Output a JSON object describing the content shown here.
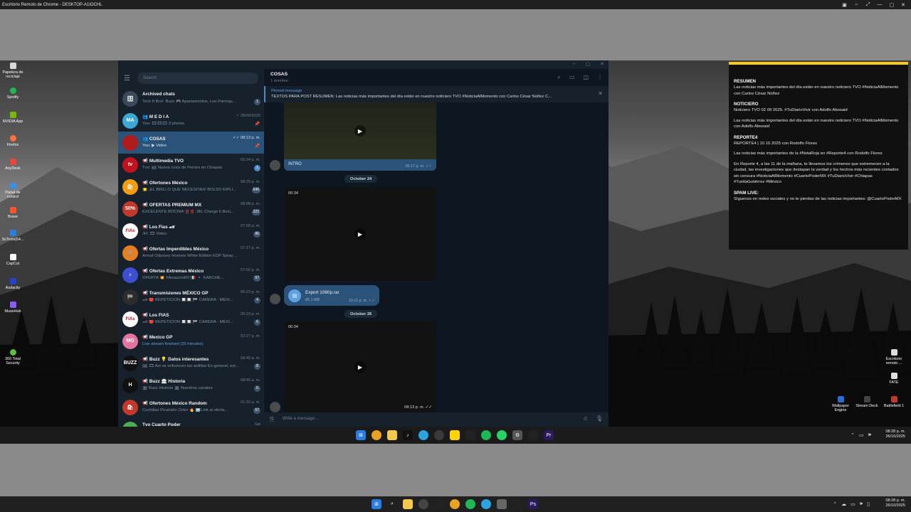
{
  "crd": {
    "title": "Escritorio Remoto de Chrome - DESKTOP-A1IOCHL",
    "controls": [
      "▣",
      "⇔",
      "⤢",
      "—",
      "▢",
      "✕"
    ]
  },
  "desktop_icons_left": [
    {
      "label": "Papelera de reciclaje",
      "color": "#d9d9d9"
    },
    {
      "label": "Spotify",
      "color": "#1db954"
    },
    {
      "label": "NVIDIA App",
      "color": "#76b900"
    },
    {
      "label": "Firefox",
      "color": "#ff7139"
    },
    {
      "label": "AnyDesk",
      "color": "#ef443b"
    },
    {
      "label": "Panel de control",
      "color": "#3c8dde"
    },
    {
      "label": "Brave",
      "color": "#fb542b"
    },
    {
      "label": "3uTools(64...",
      "color": "#2a7de1"
    },
    {
      "label": "CapCut",
      "color": "#ffffff"
    },
    {
      "label": "Audacity",
      "color": "#0000cc"
    },
    {
      "label": "MuseHub",
      "color": "#8a5cf6"
    },
    {
      "label": "360 Total Security",
      "color": "#5fbf3a"
    }
  ],
  "desktop_icons_right": [
    {
      "label": "Escritorio remoto ...",
      "color": "#dddddd"
    },
    {
      "label": "FATE",
      "color": "#dddddd"
    }
  ],
  "desktop_icons_bottom_right": [
    {
      "label": "Wallpaper Engine",
      "color": "#2a6bd6"
    },
    {
      "label": "Stream Deck",
      "color": "#333"
    },
    {
      "label": "Battlefield 1",
      "color": "#c0392b"
    }
  ],
  "telegram": {
    "search_placeholder": "Search",
    "chats": [
      {
        "name": "Archived chats",
        "preview": "Tech It Bro!: Buzz 🎮 Apartamentos, Leo Parroqu...",
        "time": "",
        "badge": "1",
        "avatar_text": "🗄",
        "avatar_color": "#3b4a5a",
        "badge_blue": false
      },
      {
        "name": "👥 M E D I A",
        "preview": "You: 🎞🎞🎞 3 photos",
        "time": "✓ 28/09/2025",
        "badge": "",
        "avatar_text": "MA",
        "avatar_color": "#3ba8d6",
        "pinned": true
      },
      {
        "name": "👥 COSAS",
        "preview": "You: ▶ Video",
        "time": "✓✓ 08:13 p. m.",
        "badge": "",
        "avatar_text": "",
        "avatar_color": "#b01b1b",
        "active": true,
        "pinned": true
      },
      {
        "name": "📢 Multimedia TVO",
        "preview": "Tvo: 🏞 Nueva crisis de Pemex en Chiapas",
        "time": "05:34 p. m.",
        "badge": "1",
        "avatar_text": "tv",
        "avatar_color": "#c1121f",
        "badge_blue": true
      },
      {
        "name": "📢 Ofertones México",
        "preview": "🌟 ¡EL BRILLO QUE NECESITAS! BOLSO KIPLI...",
        "time": "08:25 p. m.",
        "badge": "646",
        "avatar_text": "🛍",
        "avatar_color": "#f39c12"
      },
      {
        "name": "📢 OFERTAS PREMIUM MX",
        "preview": "EXCELENTE BOCINA ‼️‼️ JBL Charge 6 Boci...",
        "time": "08:08 p. m.",
        "badge": "222",
        "avatar_text": "50%",
        "avatar_color": "#c0392b"
      },
      {
        "name": "📢 Los Fias 🏎",
        "preview": "JH: 🎞 Video",
        "time": "07:58 p. m.",
        "badge": "86",
        "avatar_text": "FIAs",
        "avatar_color": "#ffffff"
      },
      {
        "name": "📢 Ofertas Imperdibles México",
        "preview": "Armaf Odyssey Homme White Edition EDP Spray ...",
        "time": "07:17 p. m.",
        "badge": "",
        "avatar_text": "🛒",
        "avatar_color": "#e67e22"
      },
      {
        "name": "📢 Ofertas Extremas México",
        "preview": "OFERTA 💥 #AmazonMX 🇲🇽 🔹 KARCHE...",
        "time": "07:00 p. m.",
        "badge": "57",
        "avatar_text": "⚡",
        "avatar_color": "#3e4fd1"
      },
      {
        "name": "📢 Transmisiones MÉXICO GP",
        "preview": "🏎 🔴 REPETICIÓN 🔲🔲 🏁 CARERA - MEXI...",
        "time": "06:23 p. m.",
        "badge": "4",
        "avatar_text": "🏁",
        "avatar_color": "#2c2c2c"
      },
      {
        "name": "📢 Los FIAS",
        "preview": "🏎 🔴 REPETICIÓN 🔲🔲 🏁 CARERA - MEXI...",
        "time": "06:23 p. m.",
        "badge": "6",
        "avatar_text": "FIAs",
        "avatar_color": "#ffffff"
      },
      {
        "name": "📢 Mexico GP",
        "preview": "Live stream finished (20 minutes)",
        "time": "02:27 p. m.",
        "badge": "",
        "avatar_text": "MG",
        "avatar_color": "#e5739f",
        "preview_blue": true
      },
      {
        "name": "📢 Buzz 💡 Datos interesantes",
        "preview": "🖼 🎞 Así se enfurecen las ardillas En general, est...",
        "time": "08:45 a. m.",
        "badge": "8",
        "avatar_text": "BUZZ",
        "avatar_color": "#111111"
      },
      {
        "name": "📢 Buzz 🏛 Historia",
        "preview": "🏛 Buzz Historia 🏛 Nuestros canales",
        "time": "08:45 a. m.",
        "badge": "6",
        "avatar_text": "H",
        "avatar_color": "#111111"
      },
      {
        "name": "📢 Ofertones México Random",
        "preview": "Cuchillas Picahielo Oster 🔥 ➡️Link al oferta...",
        "time": "01:33 a. m.",
        "badge": "57",
        "avatar_text": "🛍",
        "avatar_color": "#c0392b"
      },
      {
        "name": "Tvo Cuarto Poder",
        "preview": "",
        "time": "Sat",
        "badge": "",
        "avatar_text": "",
        "avatar_color": "#4caf50"
      }
    ],
    "chat": {
      "title": "COSAS",
      "subtitle": "1 member",
      "pinned_label": "Pinned message",
      "pinned_text": "TEXTOS PARA POST  RESUMEN:  Las noticias más importantes del día están en nuestro noticiero TVO #NoticiaAlMomento con Carlos César Núñez  C...",
      "first_caption": "INTRO",
      "first_time": "06:17 p. m. ✓✓",
      "date1": "October 24",
      "video2_duration": "00:34",
      "file_name": "Export 1080p.rar",
      "file_size": "85.1 MB",
      "file_time": "10:11 p. m. ✓✓",
      "date2": "October 26",
      "video3_duration": "00:34",
      "video3_time": "08:13 p. m. ✓✓",
      "composer_placeholder": "Write a message..."
    }
  },
  "overlay": {
    "sections": [
      {
        "heading": "RESUMEN",
        "paragraphs": [
          "Las noticias más importantes del día están en nuestro noticiero TVO #NoticiaAlMomento con Carlos César Núñez"
        ]
      },
      {
        "heading": "NOTICIERO",
        "paragraphs": [
          "Noticiero TVO 02 09 2025. #TuDiarioVivir con Adolfo Abosaid",
          "Las noticias más importantes del día están en nuestro noticiero TVO #NoticiaAlMomento con Adolfo Abosaid"
        ]
      },
      {
        "heading": "REPORTE4",
        "paragraphs": [
          "REPORTE4 | 10 10 2025 con Rodolfo Flores",
          "Las noticias más importantes de la #NotaRoja en #Reporte4 con Rodolfo Flores",
          "En Reporte 4, a las 11 de la mañana, te llevamos los crímenes que estremecen a la ciudad, las investigaciones que destapan la verdad y los hechos más recientes contados sin censura #NoticiaAlMomento #CuartoPoderMX #TuDiarioVivir #Chiapas #TuxtlaGutiérrez #México"
        ]
      },
      {
        "heading": "SPAM LIVE:",
        "paragraphs": [
          "Síguenos en redes sociales y no te pierdas de las noticias importantes: @CuartoPoderMX"
        ]
      }
    ]
  },
  "remote_taskbar": {
    "time": "08:28 p. m.",
    "date": "26/10/2025"
  },
  "local_taskbar": {
    "time": "08:28 p. m.",
    "date": "26/10/2025"
  }
}
